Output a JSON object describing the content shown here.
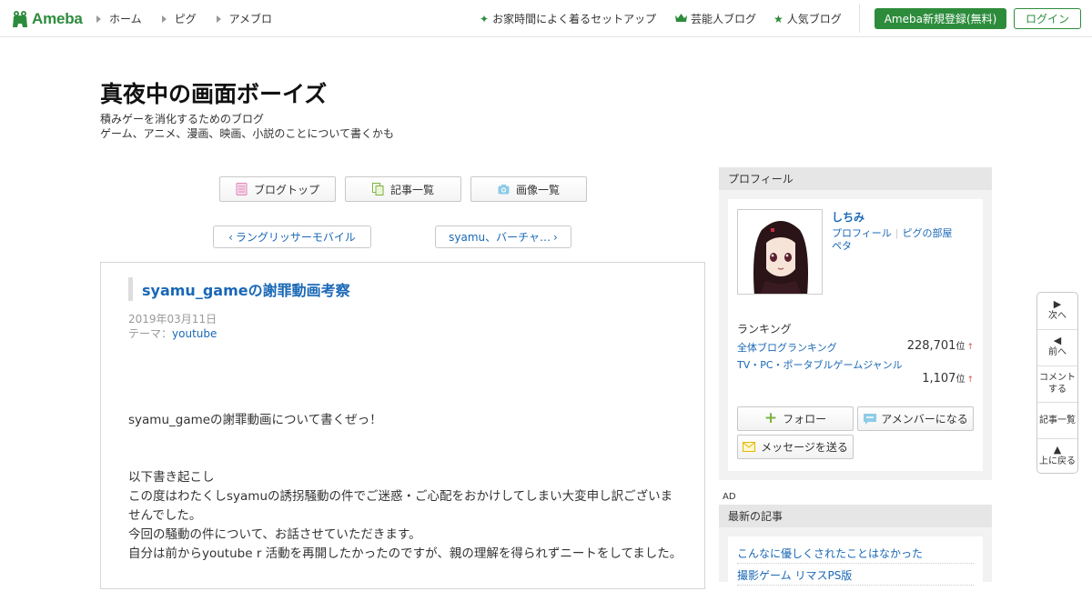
{
  "header": {
    "logo_text": "Ameba",
    "nav_left": [
      "ホーム",
      "ピグ",
      "アメブロ"
    ],
    "nav_right": [
      {
        "icon": "sparkle-icon",
        "label": "お家時間によく着るセットアップ"
      },
      {
        "icon": "crown-icon",
        "label": "芸能人ブログ"
      },
      {
        "icon": "star-icon",
        "label": "人気ブログ"
      }
    ],
    "register_label": "Ameba新規登録(無料)",
    "login_label": "ログイン"
  },
  "blog": {
    "title": "真夜中の画面ボーイズ",
    "desc_line1": "積みゲーを消化するためのブログ",
    "desc_line2": "ゲーム、アニメ、漫画、映画、小説のことについて書くかも"
  },
  "blog_nav": {
    "top_label": "ブログトップ",
    "list_label": "記事一覧",
    "images_label": "画像一覧"
  },
  "pager": {
    "prev_label": "ラングリッサーモバイル",
    "next_label": "syamu、バーチャ…"
  },
  "article": {
    "title": "syamu_gameの謝罪動画考察",
    "date": "2019年03月11日",
    "theme_prefix": "テーマ：",
    "theme": "youtube",
    "paragraph1": "syamu_gameの謝罪動画について書くぜっ！",
    "paragraph2_lines": [
      "以下書き起こし",
      "この度はわたくしsyamuの誘拐騒動の件でご迷惑・ご心配をおかけしてしまい大変申し訳ございませんでした。",
      "今回の騒動の件について、お話させていただきます。",
      "自分は前からyoutube r 活動を再開したかったのですが、親の理解を得られずニートをしてました。"
    ]
  },
  "sidebar": {
    "profile_heading": "プロフィール",
    "name": "しちみ",
    "link_profile": "プロフィール",
    "link_room": "ピグの部屋",
    "link_peta": "ペタ",
    "ranking_heading": "ランキング",
    "ranking1_label": "全体ブログランキング",
    "ranking1_value": "228,701",
    "ranking2_label": "TV・PC・ポータブルゲームジャンル",
    "ranking2_value": "1,107",
    "rank_unit": "位",
    "rank_arrow": "↑",
    "follow_label": "フォロー",
    "amember_label": "アメンバーになる",
    "message_label": "メッセージを送る",
    "ad_label": "AD",
    "latest_heading": "最新の記事",
    "latest_items": [
      "こんなに優しくされたことはなかった",
      "撮影ゲーム リマスPS版"
    ]
  },
  "float_nav": {
    "next_label": "次へ",
    "prev_label": "前へ",
    "comment_label_1": "コメント",
    "comment_label_2": "する",
    "list_label": "記事一覧",
    "top_label": "上に戻る"
  },
  "colors": {
    "brand_green": "#2d8c3c",
    "link_blue": "#1a68b6",
    "sidebar_head_bg": "#e6e6e6",
    "rank_up_red": "#d9534f"
  }
}
